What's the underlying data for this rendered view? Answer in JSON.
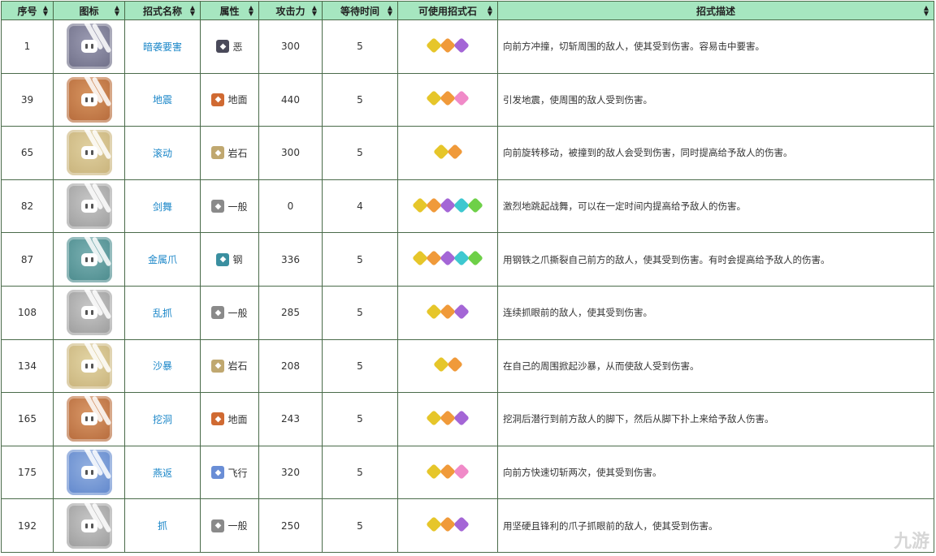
{
  "headers": [
    "序号",
    "图标",
    "招式名称",
    "属性",
    "攻击力",
    "等待时间",
    "可使用招式石",
    "招式描述"
  ],
  "colors": {
    "header_bg": "#a6e6c0",
    "link": "#1a86c8",
    "border": "#4a6b4a"
  },
  "rows": [
    {
      "no": "1",
      "name": "暗袭要害",
      "attr": "恶",
      "attr_color": "#4a4a5a",
      "power": "300",
      "wait": "5",
      "icon_bg": "#6d6d86",
      "icon_light": "#9b9bb2",
      "stones": [
        "#e6c62a",
        "#f09a3a",
        "#a466d6"
      ],
      "desc": "向前方冲撞，切斩周围的敌人，使其受到伤害。容易击中要害。"
    },
    {
      "no": "39",
      "name": "地震",
      "attr": "地面",
      "attr_color": "#d06a32",
      "power": "440",
      "wait": "5",
      "icon_bg": "#b5693a",
      "icon_light": "#d79560",
      "stones": [
        "#e6c62a",
        "#f09a3a",
        "#f08ac8"
      ],
      "desc": "引发地震，使周围的敌人受到伤害。"
    },
    {
      "no": "65",
      "name": "滚动",
      "attr": "岩石",
      "attr_color": "#c0a870",
      "power": "300",
      "wait": "5",
      "icon_bg": "#c8b27a",
      "icon_light": "#e0d0a0",
      "stones": [
        "#e6c62a",
        "#f09a3a"
      ],
      "desc": "向前旋转移动，被撞到的敌人会受到伤害，同时提高给予敌人的伤害。"
    },
    {
      "no": "82",
      "name": "剑舞",
      "attr": "一般",
      "attr_color": "#8a8a8a",
      "power": "0",
      "wait": "4",
      "icon_bg": "#9c9c9c",
      "icon_light": "#c6c6c6",
      "stones": [
        "#e6c62a",
        "#f09a3a",
        "#a466d6",
        "#3ec8d0",
        "#6ed048"
      ],
      "desc": "激烈地跳起战舞，可以在一定时间内提高给予敌人的伤害。"
    },
    {
      "no": "87",
      "name": "金属爪",
      "attr": "钢",
      "attr_color": "#3a8fa0",
      "power": "336",
      "wait": "5",
      "icon_bg": "#4a8a8c",
      "icon_light": "#7ab0b2",
      "stones": [
        "#e6c62a",
        "#f09a3a",
        "#a466d6",
        "#3ec8d0",
        "#6ed048"
      ],
      "desc": "用钢铁之爪撕裂自己前方的敌人，使其受到伤害。有时会提高给予敌人的伤害。"
    },
    {
      "no": "108",
      "name": "乱抓",
      "attr": "一般",
      "attr_color": "#8a8a8a",
      "power": "285",
      "wait": "5",
      "icon_bg": "#9a9a9a",
      "icon_light": "#c8c8c8",
      "stones": [
        "#e6c62a",
        "#f09a3a",
        "#a466d6"
      ],
      "desc": "连续抓眼前的敌人，使其受到伤害。"
    },
    {
      "no": "134",
      "name": "沙暴",
      "attr": "岩石",
      "attr_color": "#c0a870",
      "power": "208",
      "wait": "5",
      "icon_bg": "#c8b27a",
      "icon_light": "#e2d4a4",
      "stones": [
        "#e6c62a",
        "#f09a3a"
      ],
      "desc": "在自己的周围掀起沙暴，从而使敌人受到伤害。"
    },
    {
      "no": "165",
      "name": "挖洞",
      "attr": "地面",
      "attr_color": "#d06a32",
      "power": "243",
      "wait": "5",
      "icon_bg": "#b5693a",
      "icon_light": "#d99868",
      "stones": [
        "#e6c62a",
        "#f09a3a",
        "#a466d6"
      ],
      "desc": "挖洞后潜行到前方敌人的脚下，然后从脚下扑上来给予敌人伤害。"
    },
    {
      "no": "175",
      "name": "燕返",
      "attr": "飞行",
      "attr_color": "#6a8ed6",
      "power": "320",
      "wait": "5",
      "icon_bg": "#5f86cc",
      "icon_light": "#93b0e0",
      "stones": [
        "#e6c62a",
        "#f09a3a",
        "#f08ac8"
      ],
      "desc": "向前方快速切斩两次，使其受到伤害。"
    },
    {
      "no": "192",
      "name": "抓",
      "attr": "一般",
      "attr_color": "#8a8a8a",
      "power": "250",
      "wait": "5",
      "icon_bg": "#9a9a9a",
      "icon_light": "#c6c6c6",
      "stones": [
        "#e6c62a",
        "#f09a3a",
        "#a466d6"
      ],
      "desc": "用坚硬且锋利的爪子抓眼前的敌人，使其受到伤害。"
    }
  ],
  "watermark": "九游"
}
